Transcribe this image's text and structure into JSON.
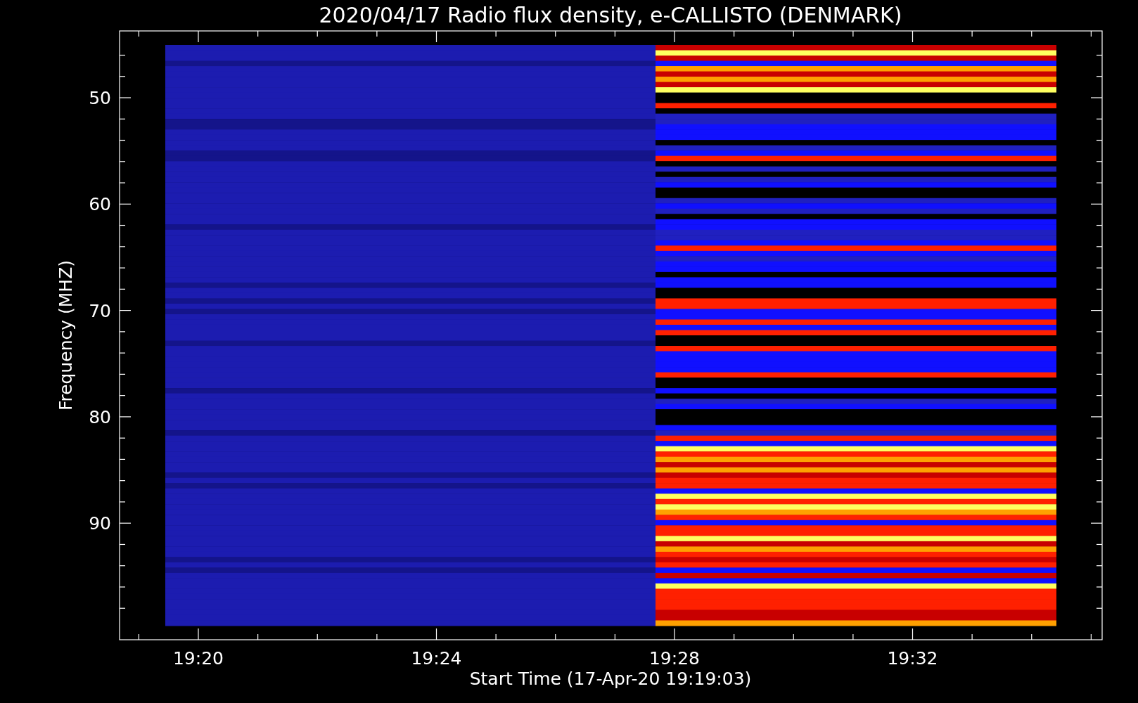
{
  "title": "2020/04/17  Radio flux density, e-CALLISTO (DENMARK)",
  "y_axis": {
    "label": "Frequency (MHZ)",
    "ticks": [
      "50",
      "60",
      "70",
      "80",
      "90"
    ]
  },
  "x_axis": {
    "label": "Start Time (17-Apr-20 19:19:03)",
    "ticks": [
      "19:20",
      "19:24",
      "19:28",
      "19:32"
    ]
  }
}
